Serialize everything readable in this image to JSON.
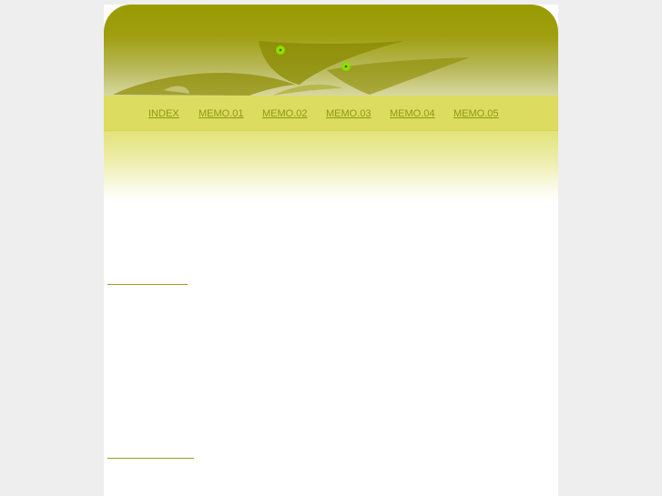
{
  "nav": {
    "items": [
      {
        "label": "INDEX"
      },
      {
        "label": "MEMO.01"
      },
      {
        "label": "MEMO.02"
      },
      {
        "label": "MEMO.03"
      },
      {
        "label": "MEMO.04"
      },
      {
        "label": "MEMO.05"
      }
    ]
  },
  "colors": {
    "page_background": "#eeeeee",
    "header_olive": "#9a9a00",
    "nav_bar": "#dcdc60",
    "nav_link": "#8c9a10",
    "accent_dot": "#7ee000"
  }
}
